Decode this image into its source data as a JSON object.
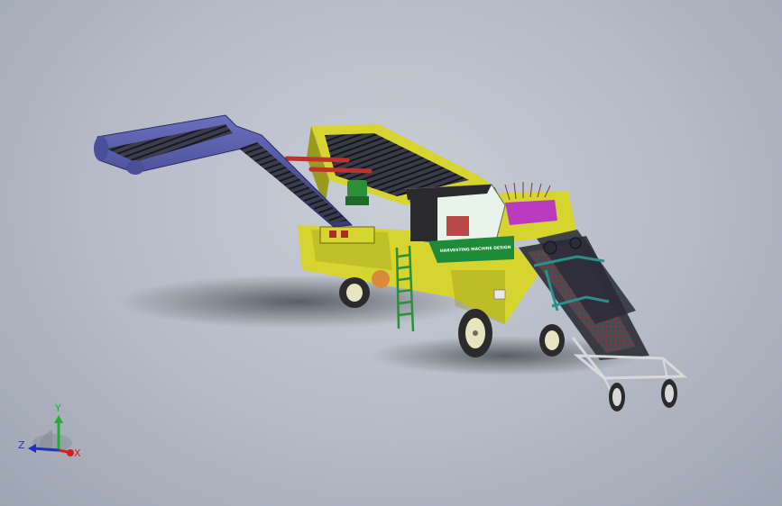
{
  "scene": {
    "colors": {
      "frame": "#d6d42e",
      "frame_dark": "#9a9a1e",
      "elevator_belt": "#4b4f9a",
      "conveyor_dark": "#2a2a3a",
      "wheel_tire": "#2b2b2b",
      "wheel_hub": "#e8e4c0",
      "cart_frame": "#d9d9dc",
      "teal_pipe": "#2b8f8a",
      "red_rod": "#c0302c",
      "magenta_drum": "#b93bc0",
      "ladder": "#2e8f3a",
      "banner": "#1f8a3a",
      "cabin_glass": "#e8f4ea",
      "cabin_roof": "#2a2a2e",
      "orange_disc": "#d98a3a"
    },
    "banner_text": "HARVESTING MACHINE DESIGN",
    "triad": {
      "x_label": "X",
      "y_label": "Y",
      "z_label": "Z",
      "x_color": "#d02020",
      "y_color": "#20b030",
      "z_color": "#2030c0"
    }
  }
}
